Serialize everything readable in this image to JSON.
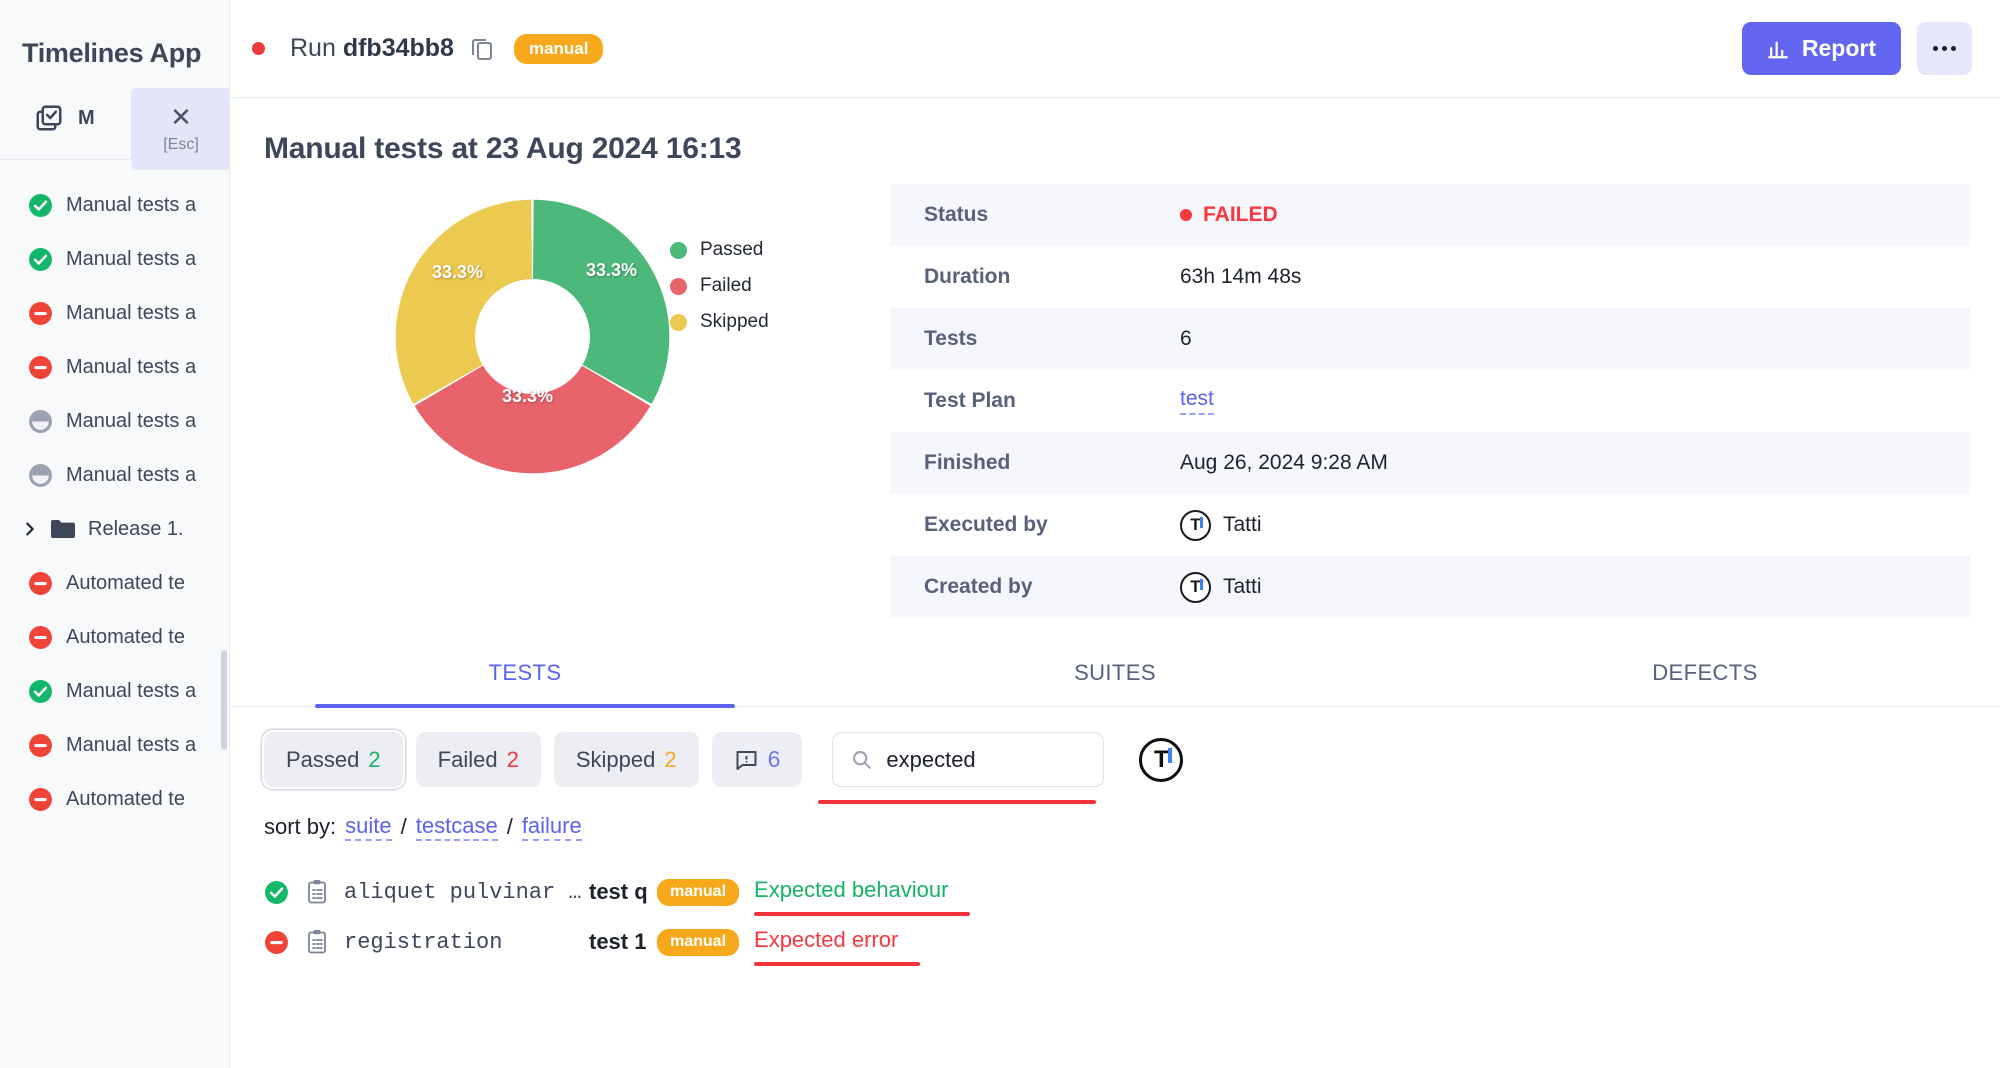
{
  "sidebar": {
    "app_title": "Timelines App",
    "tab_label": "M",
    "tab_icon": "check-square-icon",
    "esc_overlay": {
      "close_icon": "close-icon",
      "label": "[Esc]"
    },
    "items": [
      {
        "status": "passed",
        "label": "Manual tests a"
      },
      {
        "status": "passed",
        "label": "Manual tests a"
      },
      {
        "status": "failed",
        "label": "Manual tests a"
      },
      {
        "status": "failed",
        "label": "Manual tests a"
      },
      {
        "status": "skipped",
        "label": "Manual tests a"
      },
      {
        "status": "skipped",
        "label": "Manual tests a"
      },
      {
        "status": "folder",
        "label": "Release 1."
      },
      {
        "status": "failed",
        "label": "Automated te"
      },
      {
        "status": "failed",
        "label": "Automated te"
      },
      {
        "status": "passed",
        "label": "Manual tests a"
      },
      {
        "status": "failed",
        "label": "Manual tests a"
      },
      {
        "status": "failed",
        "label": "Automated te"
      }
    ]
  },
  "topbar": {
    "run_prefix": "Run",
    "run_id": "dfb34bb8",
    "copy_icon": "copy-icon",
    "badge": "manual",
    "report_label": "Report",
    "report_icon": "bar-chart-icon",
    "more_icon": "ellipsis-icon"
  },
  "page": {
    "title": "Manual tests at 23 Aug 2024 16:13"
  },
  "chart_data": {
    "type": "pie",
    "title": "",
    "categories": [
      "Passed",
      "Failed",
      "Skipped"
    ],
    "values": [
      33.3,
      33.3,
      33.3
    ],
    "labels": [
      "33.3%",
      "33.3%",
      "33.3%"
    ],
    "colors": [
      "#4cb97a",
      "#e9636b",
      "#ecc94f"
    ],
    "legend_position": "right",
    "donut": true,
    "inner_radius_ratio": 0.42
  },
  "info": {
    "rows": [
      {
        "key": "Status",
        "value": "FAILED",
        "kind": "status"
      },
      {
        "key": "Duration",
        "value": "63h 14m 48s",
        "kind": "text"
      },
      {
        "key": "Tests",
        "value": "6",
        "kind": "text"
      },
      {
        "key": "Test Plan",
        "value": "test",
        "kind": "link"
      },
      {
        "key": "Finished",
        "value": "Aug 26, 2024 9:28 AM",
        "kind": "text"
      },
      {
        "key": "Executed by",
        "value": "Tatti",
        "kind": "user",
        "avatar_initial": "T"
      },
      {
        "key": "Created by",
        "value": "Tatti",
        "kind": "user",
        "avatar_initial": "T"
      }
    ]
  },
  "tabs": [
    {
      "label": "TESTS",
      "active": true
    },
    {
      "label": "SUITES",
      "active": false
    },
    {
      "label": "DEFECTS",
      "active": false
    }
  ],
  "filters": {
    "chips": [
      {
        "label": "Passed",
        "count": "2",
        "count_color": "#16b364",
        "selected": true
      },
      {
        "label": "Failed",
        "count": "2",
        "count_color": "#f8383f",
        "selected": false
      },
      {
        "label": "Skipped",
        "count": "2",
        "count_color": "#f7a81b",
        "selected": false
      }
    ],
    "defect_chip": {
      "icon": "defect-icon",
      "count": "6",
      "count_color": "#6f76f3"
    },
    "search": {
      "value": "expected",
      "placeholder": "",
      "icon": "search-icon"
    },
    "avatar_button": {
      "initial": "T"
    }
  },
  "sort": {
    "label": "sort by:",
    "options": [
      "suite",
      "testcase",
      "failure"
    ],
    "separator": "/"
  },
  "tests": [
    {
      "status": "passed",
      "icon": "clipboard-icon",
      "suite": "aliquet pulvinar …",
      "testcase": "test q",
      "badge": "manual",
      "message": "Expected behaviour",
      "message_color": "green"
    },
    {
      "status": "failed",
      "icon": "clipboard-icon",
      "suite": "registration",
      "testcase": "test 1",
      "badge": "manual",
      "message": "Expected error",
      "message_color": "red"
    }
  ],
  "colors": {
    "accent": "#6366f1",
    "passed": "#16b364",
    "failed": "#f8383f",
    "skipped": "#f7a81b",
    "badge": "#f7a81b",
    "annotation": "#f4333d"
  }
}
